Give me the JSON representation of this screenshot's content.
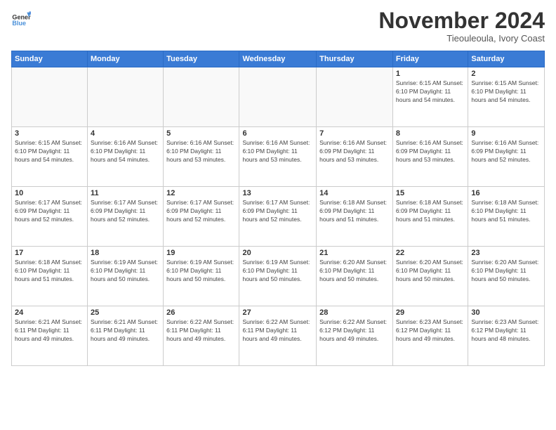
{
  "logo": {
    "line1": "General",
    "line2": "Blue"
  },
  "title": "November 2024",
  "subtitle": "Tieouleoula, Ivory Coast",
  "days_of_week": [
    "Sunday",
    "Monday",
    "Tuesday",
    "Wednesday",
    "Thursday",
    "Friday",
    "Saturday"
  ],
  "weeks": [
    [
      {
        "day": "",
        "detail": ""
      },
      {
        "day": "",
        "detail": ""
      },
      {
        "day": "",
        "detail": ""
      },
      {
        "day": "",
        "detail": ""
      },
      {
        "day": "",
        "detail": ""
      },
      {
        "day": "1",
        "detail": "Sunrise: 6:15 AM\nSunset: 6:10 PM\nDaylight: 11 hours\nand 54 minutes."
      },
      {
        "day": "2",
        "detail": "Sunrise: 6:15 AM\nSunset: 6:10 PM\nDaylight: 11 hours\nand 54 minutes."
      }
    ],
    [
      {
        "day": "3",
        "detail": "Sunrise: 6:15 AM\nSunset: 6:10 PM\nDaylight: 11 hours\nand 54 minutes."
      },
      {
        "day": "4",
        "detail": "Sunrise: 6:16 AM\nSunset: 6:10 PM\nDaylight: 11 hours\nand 54 minutes."
      },
      {
        "day": "5",
        "detail": "Sunrise: 6:16 AM\nSunset: 6:10 PM\nDaylight: 11 hours\nand 53 minutes."
      },
      {
        "day": "6",
        "detail": "Sunrise: 6:16 AM\nSunset: 6:10 PM\nDaylight: 11 hours\nand 53 minutes."
      },
      {
        "day": "7",
        "detail": "Sunrise: 6:16 AM\nSunset: 6:09 PM\nDaylight: 11 hours\nand 53 minutes."
      },
      {
        "day": "8",
        "detail": "Sunrise: 6:16 AM\nSunset: 6:09 PM\nDaylight: 11 hours\nand 53 minutes."
      },
      {
        "day": "9",
        "detail": "Sunrise: 6:16 AM\nSunset: 6:09 PM\nDaylight: 11 hours\nand 52 minutes."
      }
    ],
    [
      {
        "day": "10",
        "detail": "Sunrise: 6:17 AM\nSunset: 6:09 PM\nDaylight: 11 hours\nand 52 minutes."
      },
      {
        "day": "11",
        "detail": "Sunrise: 6:17 AM\nSunset: 6:09 PM\nDaylight: 11 hours\nand 52 minutes."
      },
      {
        "day": "12",
        "detail": "Sunrise: 6:17 AM\nSunset: 6:09 PM\nDaylight: 11 hours\nand 52 minutes."
      },
      {
        "day": "13",
        "detail": "Sunrise: 6:17 AM\nSunset: 6:09 PM\nDaylight: 11 hours\nand 52 minutes."
      },
      {
        "day": "14",
        "detail": "Sunrise: 6:18 AM\nSunset: 6:09 PM\nDaylight: 11 hours\nand 51 minutes."
      },
      {
        "day": "15",
        "detail": "Sunrise: 6:18 AM\nSunset: 6:09 PM\nDaylight: 11 hours\nand 51 minutes."
      },
      {
        "day": "16",
        "detail": "Sunrise: 6:18 AM\nSunset: 6:10 PM\nDaylight: 11 hours\nand 51 minutes."
      }
    ],
    [
      {
        "day": "17",
        "detail": "Sunrise: 6:18 AM\nSunset: 6:10 PM\nDaylight: 11 hours\nand 51 minutes."
      },
      {
        "day": "18",
        "detail": "Sunrise: 6:19 AM\nSunset: 6:10 PM\nDaylight: 11 hours\nand 50 minutes."
      },
      {
        "day": "19",
        "detail": "Sunrise: 6:19 AM\nSunset: 6:10 PM\nDaylight: 11 hours\nand 50 minutes."
      },
      {
        "day": "20",
        "detail": "Sunrise: 6:19 AM\nSunset: 6:10 PM\nDaylight: 11 hours\nand 50 minutes."
      },
      {
        "day": "21",
        "detail": "Sunrise: 6:20 AM\nSunset: 6:10 PM\nDaylight: 11 hours\nand 50 minutes."
      },
      {
        "day": "22",
        "detail": "Sunrise: 6:20 AM\nSunset: 6:10 PM\nDaylight: 11 hours\nand 50 minutes."
      },
      {
        "day": "23",
        "detail": "Sunrise: 6:20 AM\nSunset: 6:10 PM\nDaylight: 11 hours\nand 50 minutes."
      }
    ],
    [
      {
        "day": "24",
        "detail": "Sunrise: 6:21 AM\nSunset: 6:11 PM\nDaylight: 11 hours\nand 49 minutes."
      },
      {
        "day": "25",
        "detail": "Sunrise: 6:21 AM\nSunset: 6:11 PM\nDaylight: 11 hours\nand 49 minutes."
      },
      {
        "day": "26",
        "detail": "Sunrise: 6:22 AM\nSunset: 6:11 PM\nDaylight: 11 hours\nand 49 minutes."
      },
      {
        "day": "27",
        "detail": "Sunrise: 6:22 AM\nSunset: 6:11 PM\nDaylight: 11 hours\nand 49 minutes."
      },
      {
        "day": "28",
        "detail": "Sunrise: 6:22 AM\nSunset: 6:12 PM\nDaylight: 11 hours\nand 49 minutes."
      },
      {
        "day": "29",
        "detail": "Sunrise: 6:23 AM\nSunset: 6:12 PM\nDaylight: 11 hours\nand 49 minutes."
      },
      {
        "day": "30",
        "detail": "Sunrise: 6:23 AM\nSunset: 6:12 PM\nDaylight: 11 hours\nand 48 minutes."
      }
    ]
  ]
}
